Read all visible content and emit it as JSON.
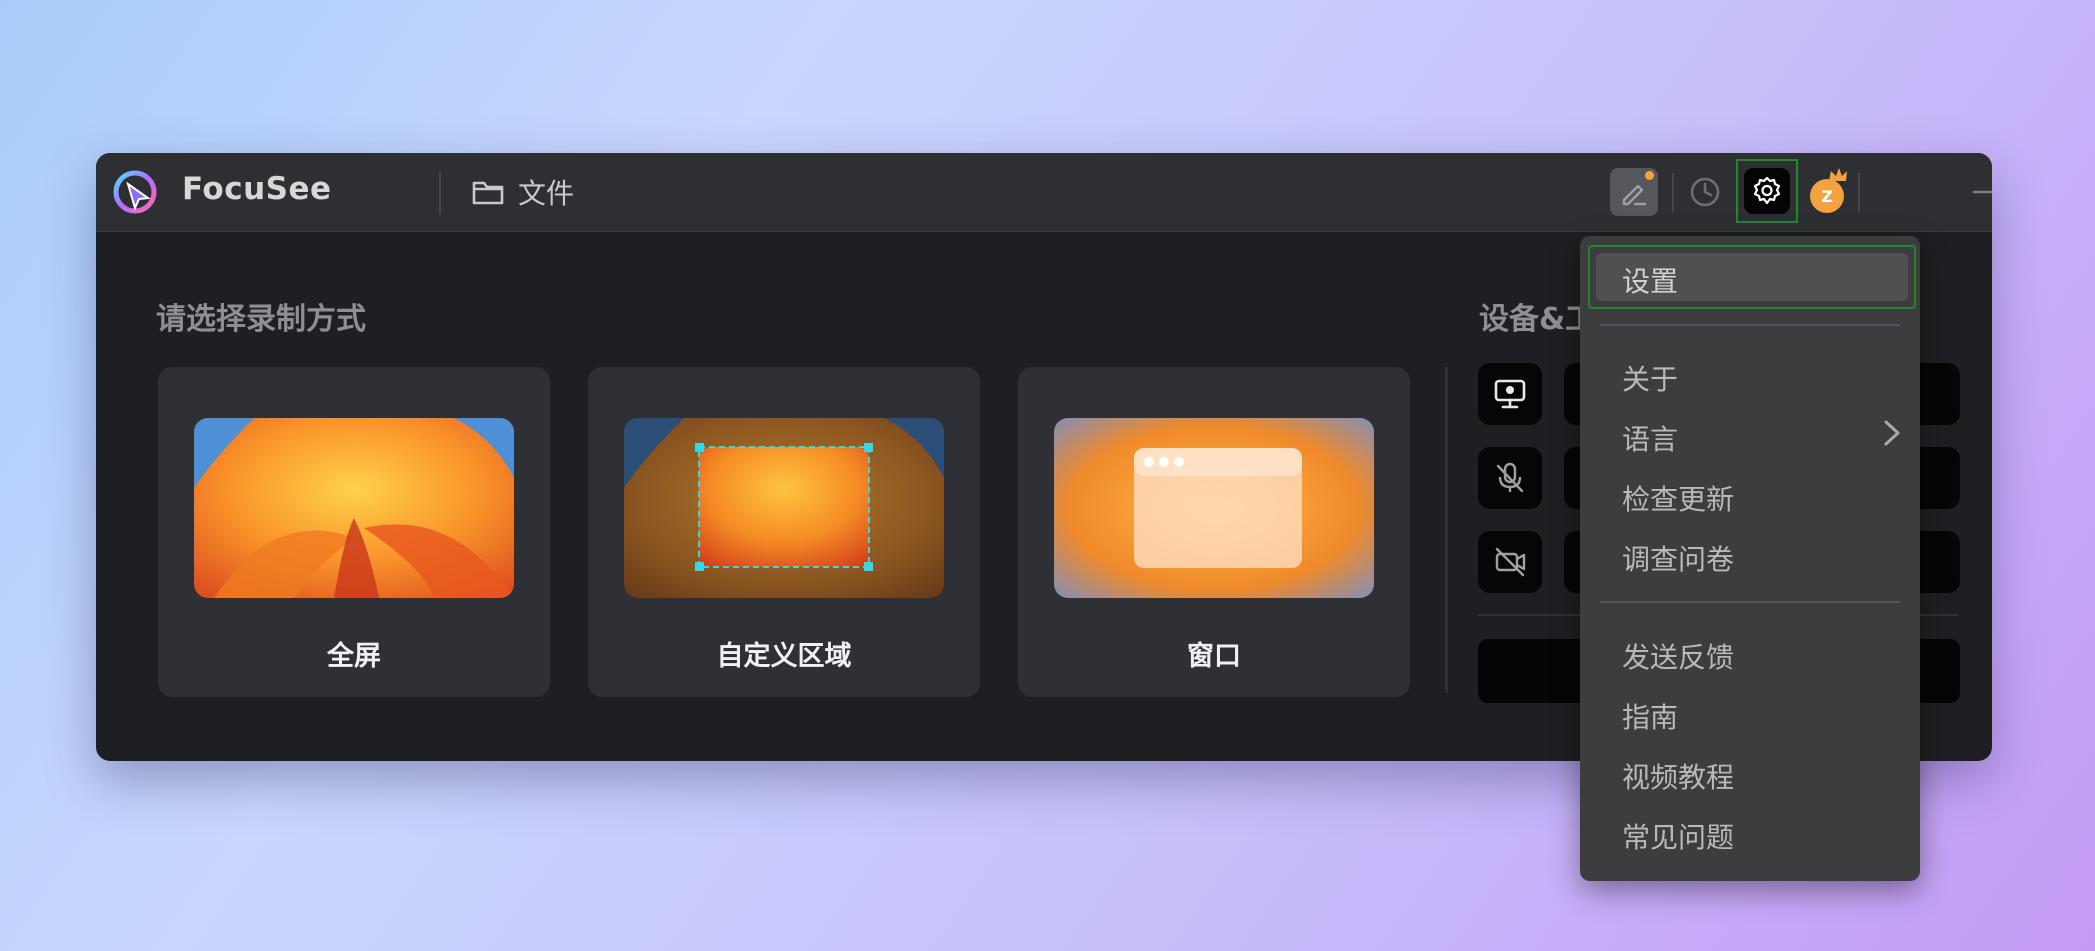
{
  "app": {
    "name": "FocuSee",
    "files_label": "文件"
  },
  "toolbar": {
    "icons": [
      "edit-icon",
      "history-icon",
      "gear-icon",
      "avatar",
      "minimize-icon",
      "close-icon"
    ],
    "avatar_letter": "Z",
    "accent_dot": "#f7a23b"
  },
  "main": {
    "record_title": "请选择录制方式",
    "modes": [
      {
        "label": "全屏"
      },
      {
        "label": "自定义区域"
      },
      {
        "label": "窗口"
      }
    ],
    "devices_title": "设备&工"
  },
  "menu": {
    "items": [
      {
        "label": "设置",
        "highlighted": true
      },
      {
        "label": "关于"
      },
      {
        "label": "语言",
        "has_submenu": true
      },
      {
        "label": "检查更新"
      },
      {
        "label": "调查问卷"
      },
      {
        "label": "发送反馈"
      },
      {
        "label": "指南"
      },
      {
        "label": "视频教程"
      },
      {
        "label": "常见问题"
      }
    ]
  },
  "colors": {
    "highlight_border": "#1f8a2a",
    "selection_handle": "#35d8e8",
    "window_bg": "#1e1f22"
  }
}
